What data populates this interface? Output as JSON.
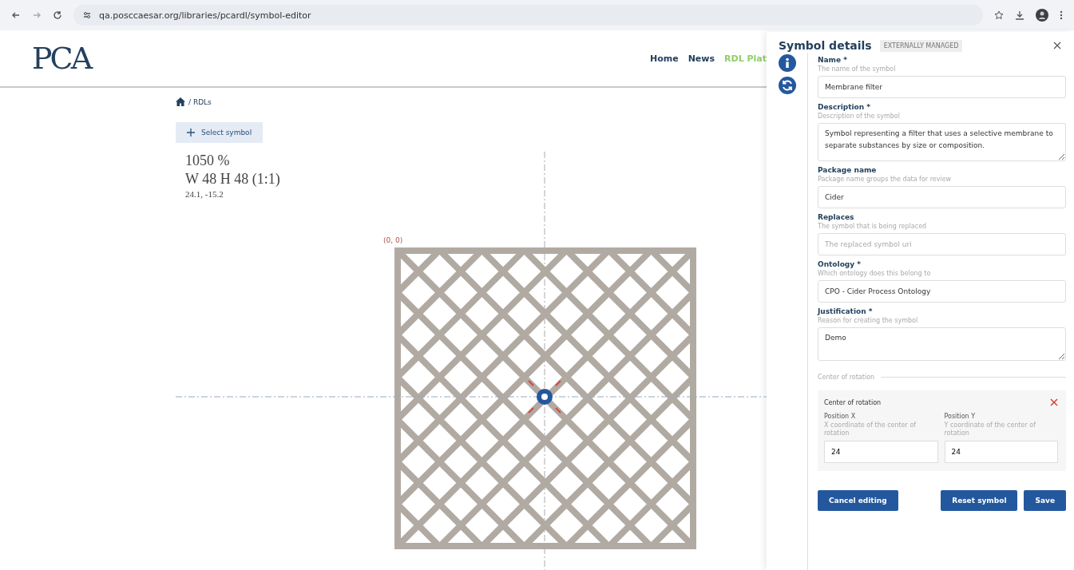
{
  "browser": {
    "url": "qa.posccaesar.org/libraries/pcardl/symbol-editor"
  },
  "header": {
    "logo": "PCA",
    "nav": [
      {
        "label": "Home",
        "selected": false
      },
      {
        "label": "News",
        "selected": false
      },
      {
        "label": "RDL Plat",
        "selected": true
      }
    ]
  },
  "breadcrumb": {
    "items": [
      "/ RDLs"
    ]
  },
  "select_button": {
    "label": "Select symbol"
  },
  "info": {
    "zoom": "1050 %",
    "size": "W 48 H 48 (1:1)",
    "cursor": "24.1, -15.2"
  },
  "canvas": {
    "origin_label": "(0, 0)"
  },
  "panel": {
    "title": "Symbol details",
    "badge": "EXTERNALLY MANAGED",
    "fields": [
      {
        "kind": "input",
        "label": "Name *",
        "hint": "The name of the symbol",
        "value": "Membrane filter"
      },
      {
        "kind": "textarea",
        "label": "Description *",
        "hint": "Description of the symbol",
        "value": "Symbol representing a filter that uses a selective membrane to separate substances by size or composition."
      },
      {
        "kind": "input",
        "label": "Package name",
        "hint": "Package name groups the data for review",
        "value": "Cider"
      },
      {
        "kind": "input",
        "label": "Replaces",
        "hint": "The symbol that is being replaced",
        "placeholder": "The replaced symbol uri"
      },
      {
        "kind": "input",
        "label": "Ontology *",
        "hint": "Which ontology does this belong to",
        "value": "CPO - Cider Process Ontology"
      },
      {
        "kind": "textarea",
        "label": "Justification *",
        "hint": "Reason for creating the symbol",
        "value": "Demo"
      }
    ],
    "section_legend": "Center of rotation",
    "rotation": {
      "title": "Center of rotation",
      "positions": [
        {
          "label": "Position X",
          "hint": "X coordinate of the center of rotation",
          "value": "24"
        },
        {
          "label": "Position Y",
          "hint": "Y coordinate of the center of rotation",
          "value": "24"
        }
      ]
    },
    "buttons": {
      "cancel": "Cancel editing",
      "reset": "Reset symbol",
      "save": "Save"
    }
  }
}
